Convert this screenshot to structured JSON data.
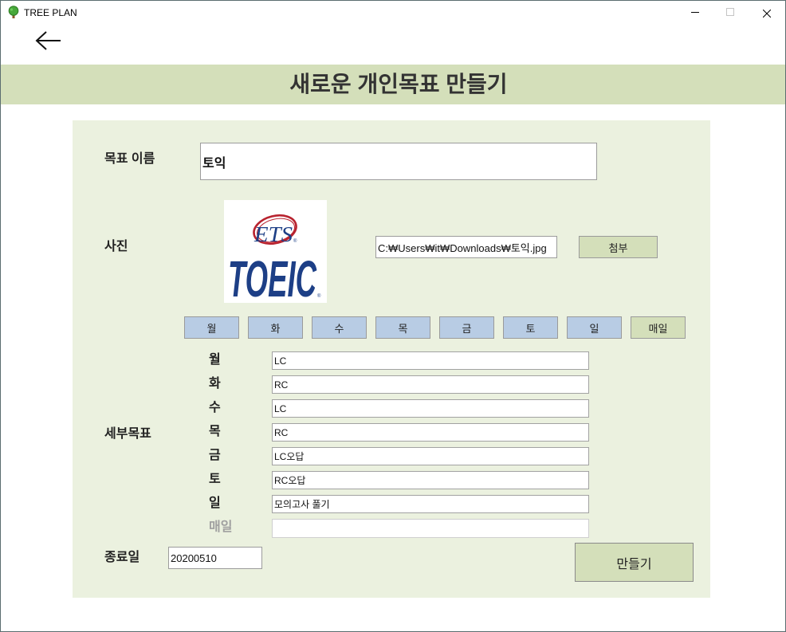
{
  "window": {
    "title": "TREE PLAN",
    "app_icon": "tree-icon",
    "controls": [
      "minimize-icon",
      "maximize-icon",
      "close-icon"
    ]
  },
  "nav": {
    "back_icon": "arrow-left-icon"
  },
  "header": {
    "title": "새로운 개인목표 만들기"
  },
  "form": {
    "goal_name": {
      "label": "목표 이름",
      "value": "토익"
    },
    "photo": {
      "label": "사진",
      "logo": {
        "top_text": "ETS",
        "main_text": "TOEIC",
        "mark": "®"
      },
      "path": "C:₩Users₩it₩Downloads₩토익.jpg",
      "attach_label": "첨부"
    },
    "days": [
      {
        "label": "월"
      },
      {
        "label": "화"
      },
      {
        "label": "수"
      },
      {
        "label": "목"
      },
      {
        "label": "금"
      },
      {
        "label": "토"
      },
      {
        "label": "일"
      },
      {
        "label": "매일"
      }
    ],
    "subgoals": {
      "label": "세부목표",
      "rows": [
        {
          "day": "월",
          "value": "LC",
          "enabled": true
        },
        {
          "day": "화",
          "value": "RC",
          "enabled": true
        },
        {
          "day": "수",
          "value": "LC",
          "enabled": true
        },
        {
          "day": "목",
          "value": "RC",
          "enabled": true
        },
        {
          "day": "금",
          "value": "LC오답",
          "enabled": true
        },
        {
          "day": "토",
          "value": "RC오답",
          "enabled": true
        },
        {
          "day": "일",
          "value": "모의고사 풀기",
          "enabled": true
        },
        {
          "day": "매일",
          "value": "",
          "enabled": false
        }
      ]
    },
    "end_date": {
      "label": "종료일",
      "value": "20200510"
    },
    "submit_label": "만들기"
  },
  "colors": {
    "header_band": "#d4dfba",
    "panel": "#ebf1df",
    "day_button": "#b8cce4",
    "green_button": "#d4dfba",
    "disabled_label": "#a0a0a0",
    "logo_red": "#b8232f",
    "logo_blue": "#1d3f86"
  }
}
